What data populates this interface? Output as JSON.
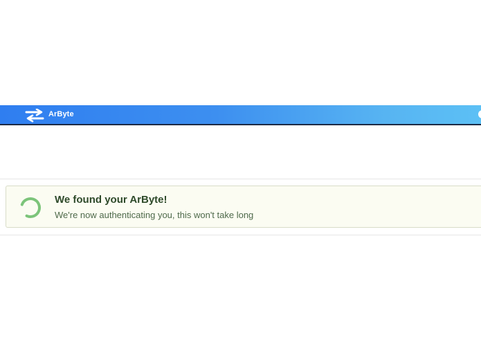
{
  "navbar": {
    "brand_name": "ArByte",
    "brand_icon": "swap-arrows-icon",
    "gradient_start": "#2f7ef0",
    "gradient_end": "#5cc0f5"
  },
  "alert": {
    "title": "We found your ArByte!",
    "message": "We're now authenticating you, this won't take long",
    "spinner_icon": "loading-spinner-icon",
    "spinner_color": "#7cc47a",
    "background": "#fbfcf2"
  }
}
